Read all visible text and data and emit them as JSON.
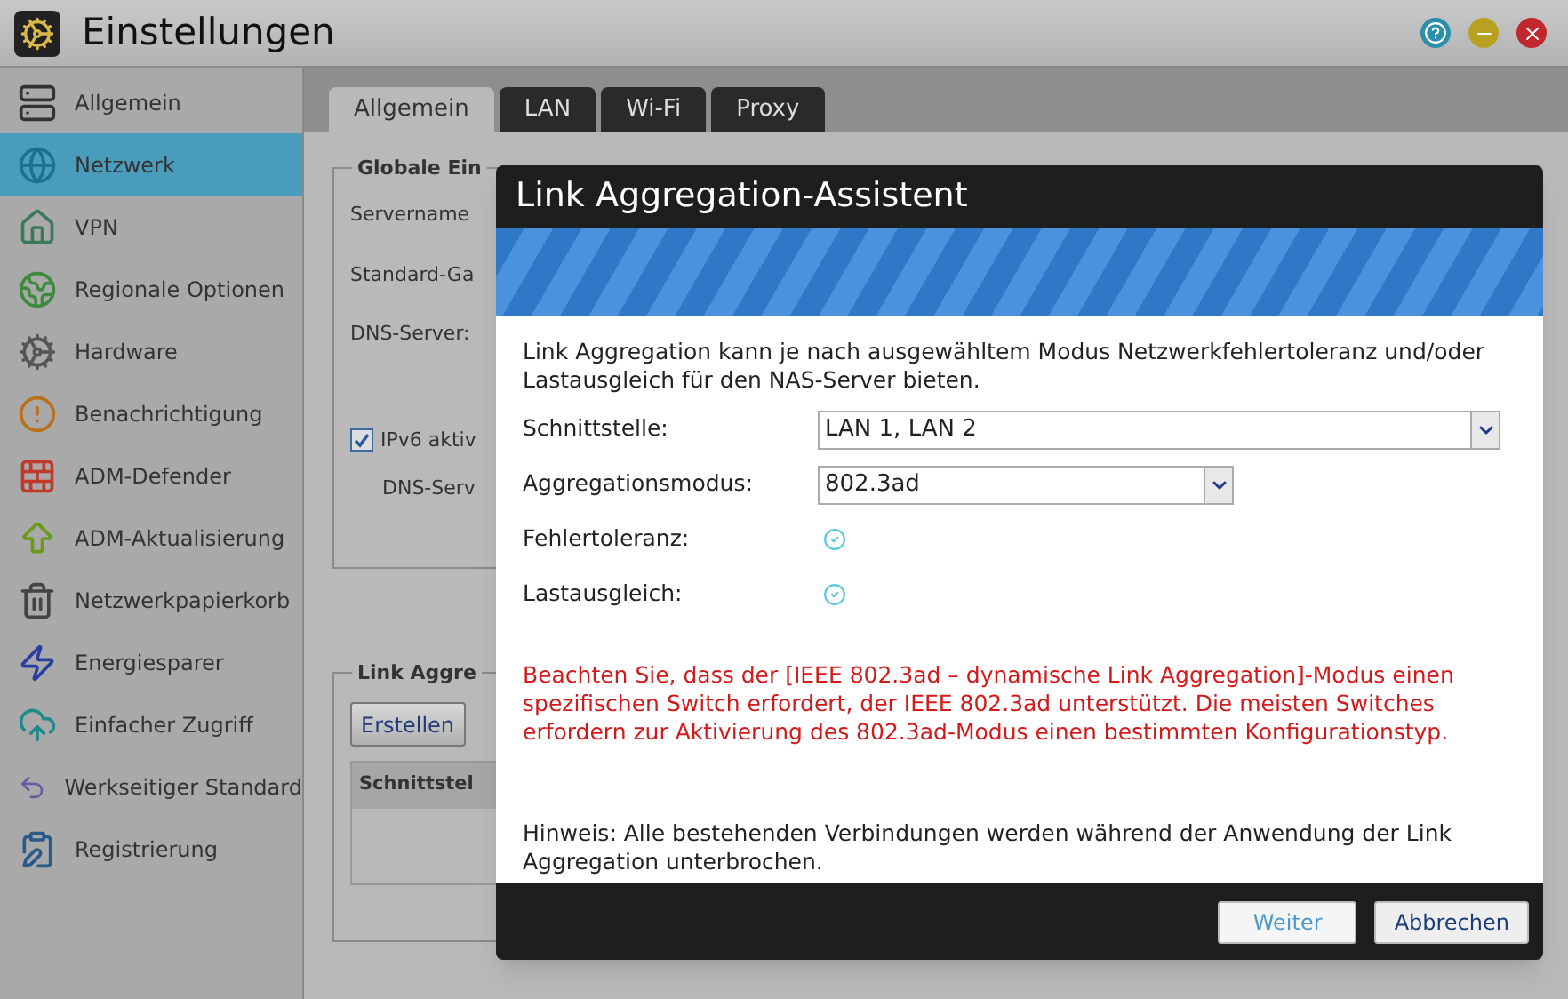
{
  "window": {
    "title": "Einstellungen"
  },
  "sidebar": {
    "items": [
      {
        "label": "Allgemein",
        "selected": false
      },
      {
        "label": "Netzwerk",
        "selected": true
      },
      {
        "label": "VPN",
        "selected": false
      },
      {
        "label": "Regionale Optionen",
        "selected": false
      },
      {
        "label": "Hardware",
        "selected": false
      },
      {
        "label": "Benachrichtigung",
        "selected": false
      },
      {
        "label": "ADM-Defender",
        "selected": false
      },
      {
        "label": "ADM-Aktualisierung",
        "selected": false
      },
      {
        "label": "Netzwerkpapierkorb",
        "selected": false
      },
      {
        "label": "Energiesparer",
        "selected": false
      },
      {
        "label": "Einfacher Zugriff",
        "selected": false
      },
      {
        "label": "Werkseitiger Standard",
        "selected": false
      },
      {
        "label": "Registrierung",
        "selected": false
      }
    ]
  },
  "tabs": [
    {
      "label": "Allgemein",
      "selected": true
    },
    {
      "label": "LAN",
      "selected": false
    },
    {
      "label": "Wi-Fi",
      "selected": false
    },
    {
      "label": "Proxy",
      "selected": false
    }
  ],
  "global_settings": {
    "legend": "Globale Ein",
    "servername_label": "Servername",
    "gateway_label": "Standard-Ga",
    "dns_label": "DNS-Server:",
    "ipv6": {
      "label": "IPv6 aktiv",
      "checked": true
    },
    "ipv6_dns_label": "DNS-Serv"
  },
  "link_aggregation": {
    "legend": "Link Aggre",
    "create_button": "Erstellen",
    "table_column": "Schnittstel"
  },
  "dialog": {
    "title": "Link Aggregation-Assistent",
    "intro": "Link Aggregation kann je nach ausgewähltem Modus Netzwerkfehlertoleranz und/oder Lastausgleich für den NAS-Server bieten.",
    "fields": [
      {
        "kind": "select",
        "label": "Schnittstelle:",
        "value": "LAN 1, LAN 2"
      },
      {
        "kind": "select",
        "label": "Aggregationsmodus:",
        "value": "802.3ad"
      },
      {
        "kind": "check",
        "label": "Fehlertoleranz:",
        "checked": true
      },
      {
        "kind": "check",
        "label": "Lastausgleich:",
        "checked": true
      }
    ],
    "warning": "Beachten Sie, dass der [IEEE 802.3ad – dynamische Link Aggregation]-Modus einen spezifischen Switch erfordert, der IEEE 802.3ad unterstützt. Die meisten Switches erfordern zur Aktivierung des 802.3ad-Modus einen bestimmten Konfigurationstyp.",
    "note": "Hinweis: Alle bestehenden Verbindungen werden während der Anwendung der Link Aggregation unterbrochen.",
    "buttons": [
      "Weiter",
      "Abbrechen"
    ]
  }
}
